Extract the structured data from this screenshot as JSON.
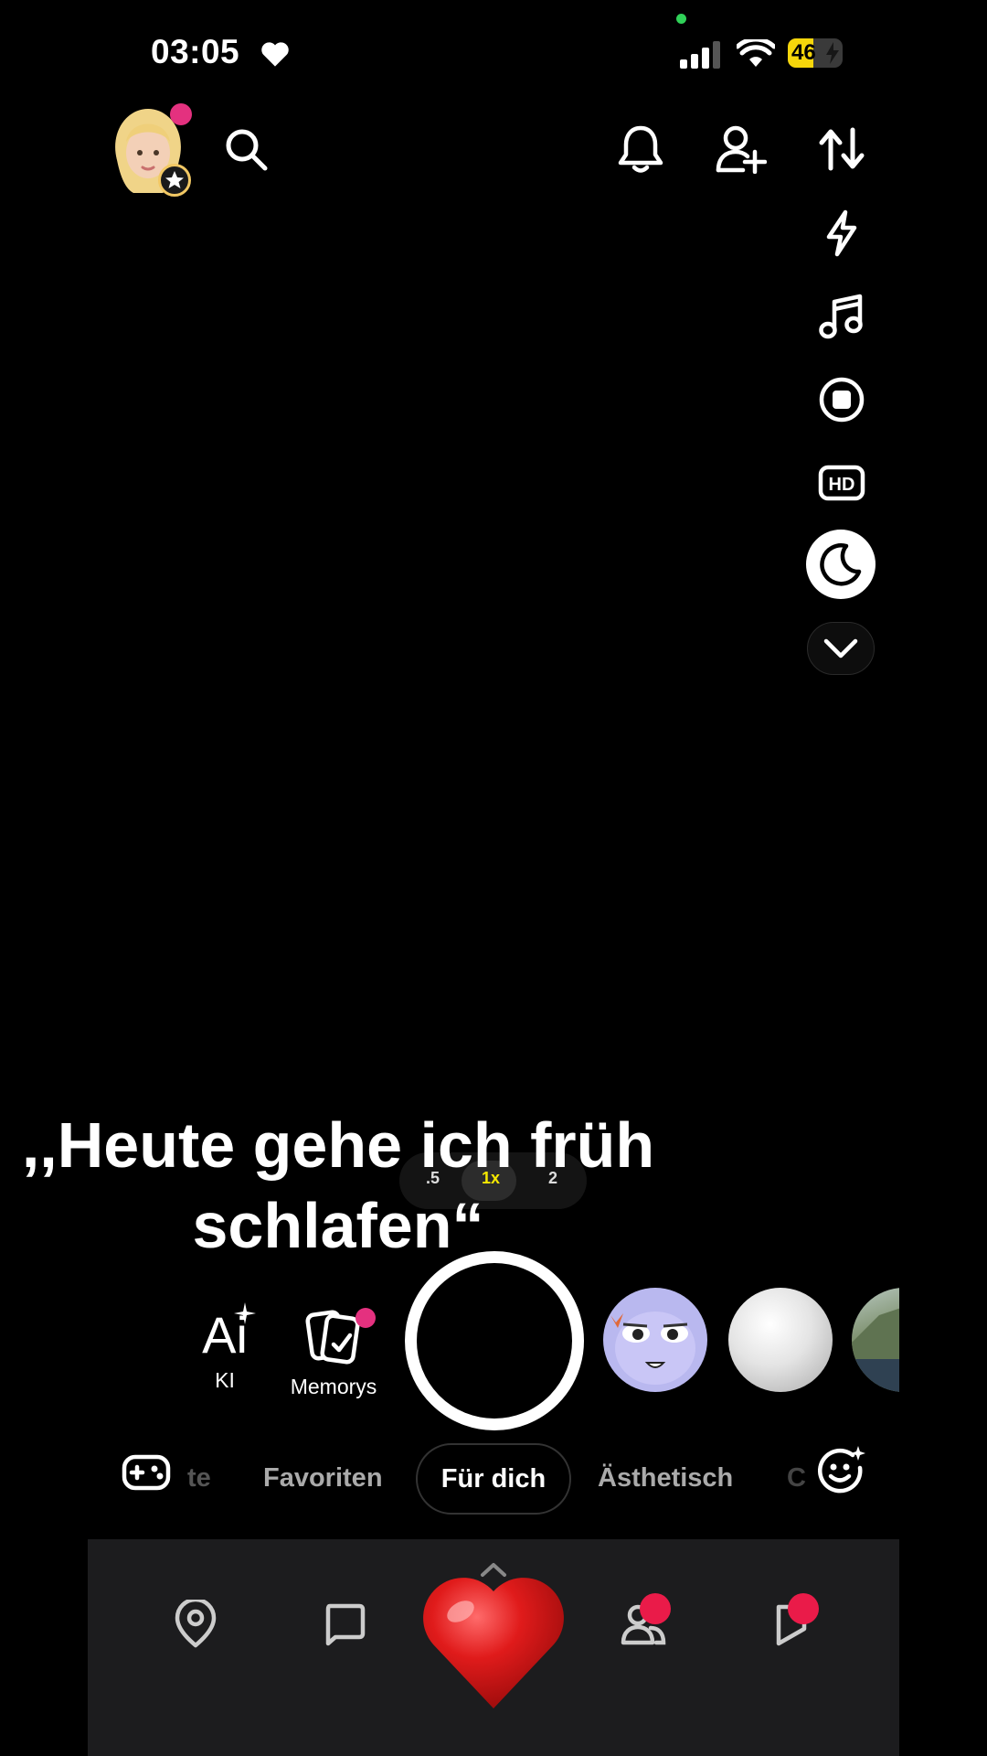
{
  "status_bar": {
    "time": "03:05",
    "battery_level": "46",
    "icons": [
      "heart-icon",
      "signal-icon",
      "wifi-icon",
      "battery-icon"
    ]
  },
  "header": {
    "left_icons": [
      "avatar",
      "search-icon"
    ],
    "right_icons": [
      "bell-icon",
      "add-friend-icon",
      "flip-camera-icon"
    ]
  },
  "right_toolbar": {
    "items": [
      "flash-icon",
      "music-icon",
      "record-icon",
      "hd-icon",
      "night-mode-icon",
      "expand-chevron-icon"
    ]
  },
  "caption": {
    "line1": ",,Heute gehe ich früh",
    "line2": "schlafen“"
  },
  "zoom": {
    "options": [
      ".5",
      "1x",
      "2"
    ],
    "selected": "1x"
  },
  "tools": {
    "ai_glyph": "Ai",
    "ai_label": "KI",
    "memories_label": "Memorys"
  },
  "lens_tabs": {
    "items": [
      "te",
      "Favoriten",
      "Für dich",
      "Ästhetisch",
      "C"
    ],
    "active": "Für dich"
  },
  "bottom_nav": {
    "items": [
      "map-icon",
      "chat-icon",
      "camera-heart-icon",
      "friends-icon",
      "stories-icon"
    ]
  },
  "colors": {
    "accent_pink": "#e4317f",
    "badge_red": "#ea1b49",
    "zoom_active": "#f6e800",
    "battery": "#f6d60b"
  }
}
